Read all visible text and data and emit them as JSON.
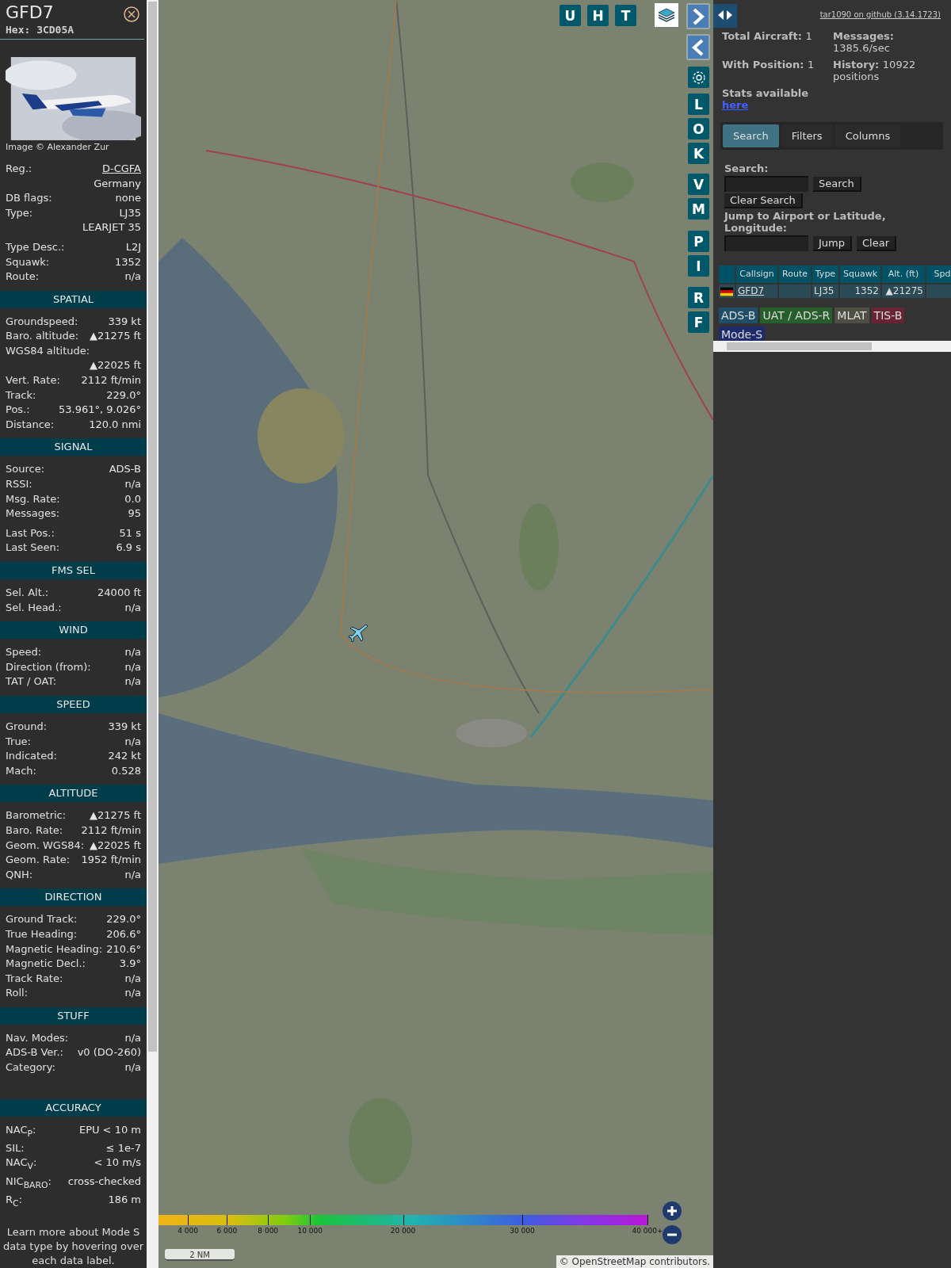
{
  "sidebar": {
    "title": "GFD7",
    "hex": "Hex: 3CD05A",
    "photo_credit": "Image © Alexander Zur",
    "groups": [
      [
        {
          "label": "Reg.:",
          "value": "D-CGFA",
          "kind": "link"
        },
        {
          "value": "Germany"
        },
        {
          "label": "DB flags:",
          "value": "none"
        },
        {
          "label": "Type:",
          "value": "LJ35"
        },
        {
          "value": "LEARJET 35"
        }
      ],
      [
        {
          "label": "Type Desc.:",
          "value": "L2J"
        },
        {
          "label": "Squawk:",
          "value": "1352"
        },
        {
          "label": "Route:",
          "value": "n/a"
        }
      ]
    ],
    "sections": [
      {
        "title": "SPATIAL",
        "groups": [
          [
            {
              "label": "Groundspeed:",
              "value": "339 kt"
            },
            {
              "label": "Baro. altitude:",
              "value": "▲21275 ft"
            },
            {
              "label": "WGS84 altitude:"
            },
            {
              "value": "▲22025 ft"
            },
            {
              "label": "Vert. Rate:",
              "value": "2112 ft/min"
            },
            {
              "label": "Track:",
              "value": "229.0°"
            },
            {
              "label": "Pos.:",
              "value": "53.961°, 9.026°"
            },
            {
              "label": "Distance:",
              "value": "120.0 nmi"
            }
          ]
        ]
      },
      {
        "title": "SIGNAL",
        "groups": [
          [
            {
              "label": "Source:",
              "value": "ADS-B"
            },
            {
              "label": "RSSI:",
              "value": "n/a"
            },
            {
              "label": "Msg. Rate:",
              "value": "0.0"
            },
            {
              "label": "Messages:",
              "value": "95"
            }
          ],
          [
            {
              "label": "Last Pos.:",
              "value": "51 s"
            },
            {
              "label": "Last Seen:",
              "value": "6.9 s"
            }
          ]
        ]
      },
      {
        "title": "FMS SEL",
        "groups": [
          [
            {
              "label": "Sel. Alt.:",
              "value": "24000 ft"
            },
            {
              "label": "Sel. Head.:",
              "value": "n/a"
            }
          ]
        ]
      },
      {
        "title": "WIND",
        "groups": [
          [
            {
              "label": "Speed:",
              "value": "n/a"
            },
            {
              "label": "Direction (from):",
              "value": "n/a"
            },
            {
              "label": "TAT / OAT:",
              "value": "n/a"
            }
          ]
        ]
      },
      {
        "title": "SPEED",
        "groups": [
          [
            {
              "label": "Ground:",
              "value": "339 kt"
            },
            {
              "label": "True:",
              "value": "n/a"
            },
            {
              "label": "Indicated:",
              "value": "242 kt"
            },
            {
              "label": "Mach:",
              "value": "0.528"
            }
          ]
        ]
      },
      {
        "title": "ALTITUDE",
        "groups": [
          [
            {
              "label": "Barometric:",
              "value": "▲21275 ft"
            },
            {
              "label": "Baro. Rate:",
              "value": "2112 ft/min"
            },
            {
              "label": "Geom. WGS84:",
              "value": "▲22025 ft"
            },
            {
              "label": "Geom. Rate:",
              "value": "1952 ft/min"
            },
            {
              "label": "QNH:",
              "value": "n/a"
            }
          ]
        ]
      },
      {
        "title": "DIRECTION",
        "groups": [
          [
            {
              "label": "Ground Track:",
              "value": "229.0°"
            },
            {
              "label": "True Heading:",
              "value": "206.6°"
            },
            {
              "label": "Magnetic Heading:",
              "value": "210.6°"
            },
            {
              "label": "Magnetic Decl.:",
              "value": "3.9°"
            },
            {
              "label": "Track Rate:",
              "value": "n/a"
            },
            {
              "label": "Roll:",
              "value": "n/a"
            }
          ]
        ]
      },
      {
        "title": "STUFF",
        "groups": [
          [
            {
              "label": "Nav. Modes:",
              "value": "n/a"
            },
            {
              "label": "ADS-B Ver.:",
              "value": "v0 (DO-260)"
            },
            {
              "label": "Category:",
              "value": "n/a"
            }
          ]
        ],
        "spacer_after": true
      },
      {
        "title": "ACCURACY",
        "groups": [
          [
            {
              "label": "NAC$_{P}$:",
              "value": "EPU < 10 m"
            },
            {
              "label": "SIL:",
              "value": "≤ 1e-7"
            },
            {
              "label": "NAC$_{V}$:",
              "value": "< 10 m/s"
            },
            {
              "label": "NIC$_{BARO}$:",
              "value": "cross-checked"
            },
            {
              "label": "R$_{C}$:",
              "value": "186 m"
            }
          ]
        ]
      }
    ],
    "footer": "Learn more about Mode S data type by hovering over each data label."
  },
  "map": {
    "top_buttons": [
      "U",
      "H",
      "T"
    ],
    "side_buttons": [
      [
        "L",
        "O",
        "K"
      ],
      [
        "V",
        "M"
      ],
      [
        "P",
        "I"
      ],
      [
        "R",
        "F"
      ]
    ],
    "altitude_scale": [
      "4 000",
      "6 000",
      "8 000",
      "10 000",
      "20 000",
      "30 000",
      "40 000+"
    ],
    "scale_bar": "2 NM",
    "attribution": {
      "symbol": "©",
      "link": "OpenStreetMap",
      "text": "contributors."
    }
  },
  "panel": {
    "github_link": "tar1090 on github (3.14.1723)",
    "stats": [
      {
        "label": "Total Aircraft:",
        "value": "1"
      },
      {
        "label": "Messages:",
        "value": "1385.6/sec"
      },
      {
        "label": "With Position:",
        "value": "1"
      },
      {
        "label": "History:",
        "value": "10922 positions"
      }
    ],
    "stats_note": "Stats available",
    "stats_link": "here",
    "tabs": [
      {
        "label": "Search",
        "selected": true
      },
      {
        "label": "Filters",
        "selected": false
      },
      {
        "label": "Columns",
        "selected": false
      }
    ],
    "search": {
      "label": "Search:",
      "button": "Search",
      "clear_button": "Clear Search"
    },
    "jump": {
      "label": "Jump to Airport or Latitude, Longitude:",
      "button": "Jump",
      "clear_button": "Clear"
    },
    "table": {
      "columns": [
        "Callsign",
        "Route",
        "Type",
        "Squawk",
        "Alt. (ft)",
        "Spd"
      ],
      "rows": [
        {
          "callsign": "GFD7",
          "type": "LJ35",
          "squawk": "1352",
          "altitude": "▲21275"
        }
      ]
    },
    "legend": [
      {
        "label": "ADS-B",
        "color": "#1f4e68"
      },
      {
        "label": "UAT / ADS-R",
        "color": "#265e2c"
      },
      {
        "label": "MLAT",
        "color": "#4f4e43"
      },
      {
        "label": "TIS-B",
        "color": "#682432"
      },
      {
        "label": "Mode-S",
        "color": "#1f2c6b"
      }
    ]
  }
}
